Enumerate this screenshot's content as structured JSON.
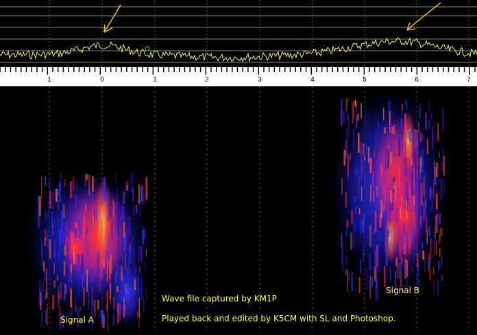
{
  "ruler": {
    "ticks": [
      "1",
      "0",
      "1",
      "2",
      "3",
      "4",
      "5",
      "6",
      "7"
    ]
  },
  "annotations": {
    "signal_a": "Signal A",
    "signal_b": "Signal B",
    "credit_capture": "Wave file captured by KM1P",
    "credit_edit": "Played back and edited by K5CM with SL and Photoshop."
  },
  "colors": {
    "trace": "#f2ee6a",
    "grid": "#8a8a8a",
    "annotation": "#ffff40",
    "arrow": "#d9b43a"
  }
}
